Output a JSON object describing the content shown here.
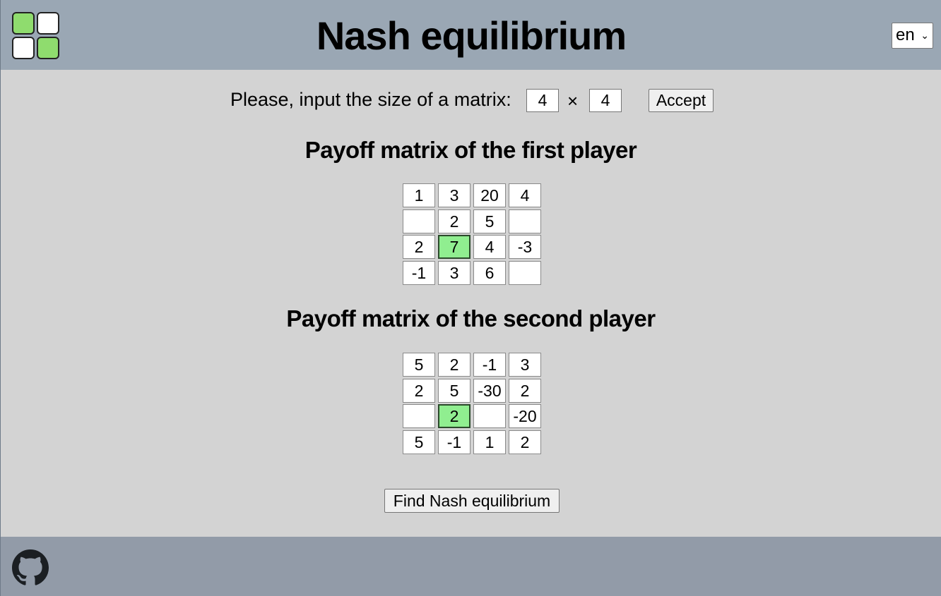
{
  "header": {
    "title": "Nash equilibrium",
    "language": "en",
    "logo_icon": "grid-logo-icon",
    "colors": {
      "header_bg": "#9aa7b4",
      "accent_green": "#8fdc6e"
    }
  },
  "size_form": {
    "label": "Please, input the size of a matrix:",
    "rows": "4",
    "cols": "4",
    "times": "×",
    "accept_label": "Accept"
  },
  "matrix1": {
    "title": "Payoff matrix of the first player",
    "cells": [
      [
        "1",
        "3",
        "20",
        "4"
      ],
      [
        "",
        "2",
        "5",
        ""
      ],
      [
        "2",
        "7",
        "4",
        "-3"
      ],
      [
        "-1",
        "3",
        "6",
        ""
      ]
    ],
    "highlight": [
      2,
      1
    ]
  },
  "matrix2": {
    "title": "Payoff matrix of the second player",
    "cells": [
      [
        "5",
        "2",
        "-1",
        "3"
      ],
      [
        "2",
        "5",
        "-30",
        "2"
      ],
      [
        "",
        "2",
        "",
        "-20"
      ],
      [
        "5",
        "-1",
        "1",
        "2"
      ]
    ],
    "highlight": [
      2,
      1
    ]
  },
  "find_label": "Find Nash equilibrium",
  "footer": {
    "github_icon": "github-icon",
    "highlight_color": "#90ee90"
  }
}
